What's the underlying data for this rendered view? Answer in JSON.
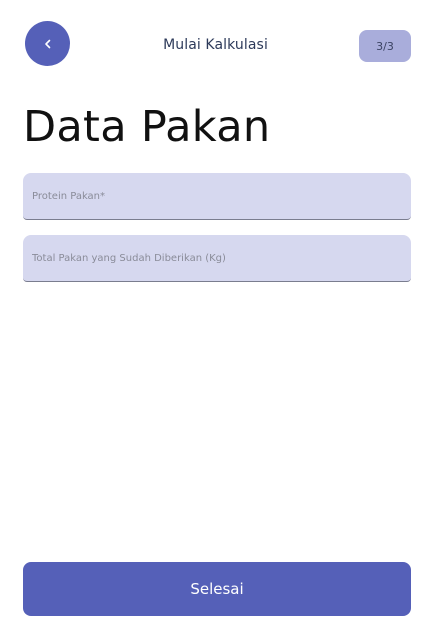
{
  "header": {
    "back_icon": "chevron-left-icon",
    "title": "Mulai Kalkulasi",
    "step": "3/3"
  },
  "page": {
    "title": "Data Pakan"
  },
  "form": {
    "protein": {
      "placeholder": "Protein Pakan*",
      "value": ""
    },
    "total_feed": {
      "placeholder": "Total Pakan yang Sudah Diberikan (Kg)",
      "value": ""
    }
  },
  "actions": {
    "submit_label": "Selesai"
  },
  "colors": {
    "accent": "#5560b8",
    "badge": "#a9addb",
    "field_bg": "#d6d8ef"
  }
}
